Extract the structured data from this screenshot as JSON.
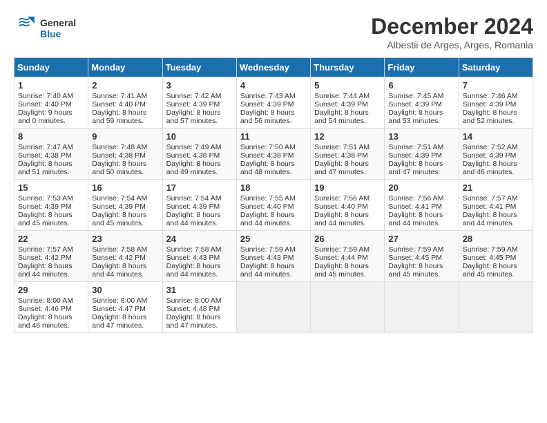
{
  "header": {
    "logo_line1": "General",
    "logo_line2": "Blue",
    "month": "December 2024",
    "location": "Albestii de Arges, Arges, Romania"
  },
  "days_of_week": [
    "Sunday",
    "Monday",
    "Tuesday",
    "Wednesday",
    "Thursday",
    "Friday",
    "Saturday"
  ],
  "weeks": [
    [
      {
        "day": "1",
        "sunrise": "Sunrise: 7:40 AM",
        "sunset": "Sunset: 4:40 PM",
        "daylight": "Daylight: 9 hours and 0 minutes."
      },
      {
        "day": "2",
        "sunrise": "Sunrise: 7:41 AM",
        "sunset": "Sunset: 4:40 PM",
        "daylight": "Daylight: 8 hours and 59 minutes."
      },
      {
        "day": "3",
        "sunrise": "Sunrise: 7:42 AM",
        "sunset": "Sunset: 4:39 PM",
        "daylight": "Daylight: 8 hours and 57 minutes."
      },
      {
        "day": "4",
        "sunrise": "Sunrise: 7:43 AM",
        "sunset": "Sunset: 4:39 PM",
        "daylight": "Daylight: 8 hours and 56 minutes."
      },
      {
        "day": "5",
        "sunrise": "Sunrise: 7:44 AM",
        "sunset": "Sunset: 4:39 PM",
        "daylight": "Daylight: 8 hours and 54 minutes."
      },
      {
        "day": "6",
        "sunrise": "Sunrise: 7:45 AM",
        "sunset": "Sunset: 4:39 PM",
        "daylight": "Daylight: 8 hours and 53 minutes."
      },
      {
        "day": "7",
        "sunrise": "Sunrise: 7:46 AM",
        "sunset": "Sunset: 4:39 PM",
        "daylight": "Daylight: 8 hours and 52 minutes."
      }
    ],
    [
      {
        "day": "8",
        "sunrise": "Sunrise: 7:47 AM",
        "sunset": "Sunset: 4:38 PM",
        "daylight": "Daylight: 8 hours and 51 minutes."
      },
      {
        "day": "9",
        "sunrise": "Sunrise: 7:48 AM",
        "sunset": "Sunset: 4:38 PM",
        "daylight": "Daylight: 8 hours and 50 minutes."
      },
      {
        "day": "10",
        "sunrise": "Sunrise: 7:49 AM",
        "sunset": "Sunset: 4:38 PM",
        "daylight": "Daylight: 8 hours and 49 minutes."
      },
      {
        "day": "11",
        "sunrise": "Sunrise: 7:50 AM",
        "sunset": "Sunset: 4:38 PM",
        "daylight": "Daylight: 8 hours and 48 minutes."
      },
      {
        "day": "12",
        "sunrise": "Sunrise: 7:51 AM",
        "sunset": "Sunset: 4:38 PM",
        "daylight": "Daylight: 8 hours and 47 minutes."
      },
      {
        "day": "13",
        "sunrise": "Sunrise: 7:51 AM",
        "sunset": "Sunset: 4:39 PM",
        "daylight": "Daylight: 8 hours and 47 minutes."
      },
      {
        "day": "14",
        "sunrise": "Sunrise: 7:52 AM",
        "sunset": "Sunset: 4:39 PM",
        "daylight": "Daylight: 8 hours and 46 minutes."
      }
    ],
    [
      {
        "day": "15",
        "sunrise": "Sunrise: 7:53 AM",
        "sunset": "Sunset: 4:39 PM",
        "daylight": "Daylight: 8 hours and 45 minutes."
      },
      {
        "day": "16",
        "sunrise": "Sunrise: 7:54 AM",
        "sunset": "Sunset: 4:39 PM",
        "daylight": "Daylight: 8 hours and 45 minutes."
      },
      {
        "day": "17",
        "sunrise": "Sunrise: 7:54 AM",
        "sunset": "Sunset: 4:39 PM",
        "daylight": "Daylight: 8 hours and 44 minutes."
      },
      {
        "day": "18",
        "sunrise": "Sunrise: 7:55 AM",
        "sunset": "Sunset: 4:40 PM",
        "daylight": "Daylight: 8 hours and 44 minutes."
      },
      {
        "day": "19",
        "sunrise": "Sunrise: 7:56 AM",
        "sunset": "Sunset: 4:40 PM",
        "daylight": "Daylight: 8 hours and 44 minutes."
      },
      {
        "day": "20",
        "sunrise": "Sunrise: 7:56 AM",
        "sunset": "Sunset: 4:41 PM",
        "daylight": "Daylight: 8 hours and 44 minutes."
      },
      {
        "day": "21",
        "sunrise": "Sunrise: 7:57 AM",
        "sunset": "Sunset: 4:41 PM",
        "daylight": "Daylight: 8 hours and 44 minutes."
      }
    ],
    [
      {
        "day": "22",
        "sunrise": "Sunrise: 7:57 AM",
        "sunset": "Sunset: 4:42 PM",
        "daylight": "Daylight: 8 hours and 44 minutes."
      },
      {
        "day": "23",
        "sunrise": "Sunrise: 7:58 AM",
        "sunset": "Sunset: 4:42 PM",
        "daylight": "Daylight: 8 hours and 44 minutes."
      },
      {
        "day": "24",
        "sunrise": "Sunrise: 7:58 AM",
        "sunset": "Sunset: 4:43 PM",
        "daylight": "Daylight: 8 hours and 44 minutes."
      },
      {
        "day": "25",
        "sunrise": "Sunrise: 7:59 AM",
        "sunset": "Sunset: 4:43 PM",
        "daylight": "Daylight: 8 hours and 44 minutes."
      },
      {
        "day": "26",
        "sunrise": "Sunrise: 7:59 AM",
        "sunset": "Sunset: 4:44 PM",
        "daylight": "Daylight: 8 hours and 45 minutes."
      },
      {
        "day": "27",
        "sunrise": "Sunrise: 7:59 AM",
        "sunset": "Sunset: 4:45 PM",
        "daylight": "Daylight: 8 hours and 45 minutes."
      },
      {
        "day": "28",
        "sunrise": "Sunrise: 7:59 AM",
        "sunset": "Sunset: 4:45 PM",
        "daylight": "Daylight: 8 hours and 45 minutes."
      }
    ],
    [
      {
        "day": "29",
        "sunrise": "Sunrise: 8:00 AM",
        "sunset": "Sunset: 4:46 PM",
        "daylight": "Daylight: 8 hours and 46 minutes."
      },
      {
        "day": "30",
        "sunrise": "Sunrise: 8:00 AM",
        "sunset": "Sunset: 4:47 PM",
        "daylight": "Daylight: 8 hours and 47 minutes."
      },
      {
        "day": "31",
        "sunrise": "Sunrise: 8:00 AM",
        "sunset": "Sunset: 4:48 PM",
        "daylight": "Daylight: 8 hours and 47 minutes."
      },
      {
        "day": "",
        "sunrise": "",
        "sunset": "",
        "daylight": ""
      },
      {
        "day": "",
        "sunrise": "",
        "sunset": "",
        "daylight": ""
      },
      {
        "day": "",
        "sunrise": "",
        "sunset": "",
        "daylight": ""
      },
      {
        "day": "",
        "sunrise": "",
        "sunset": "",
        "daylight": ""
      }
    ]
  ]
}
